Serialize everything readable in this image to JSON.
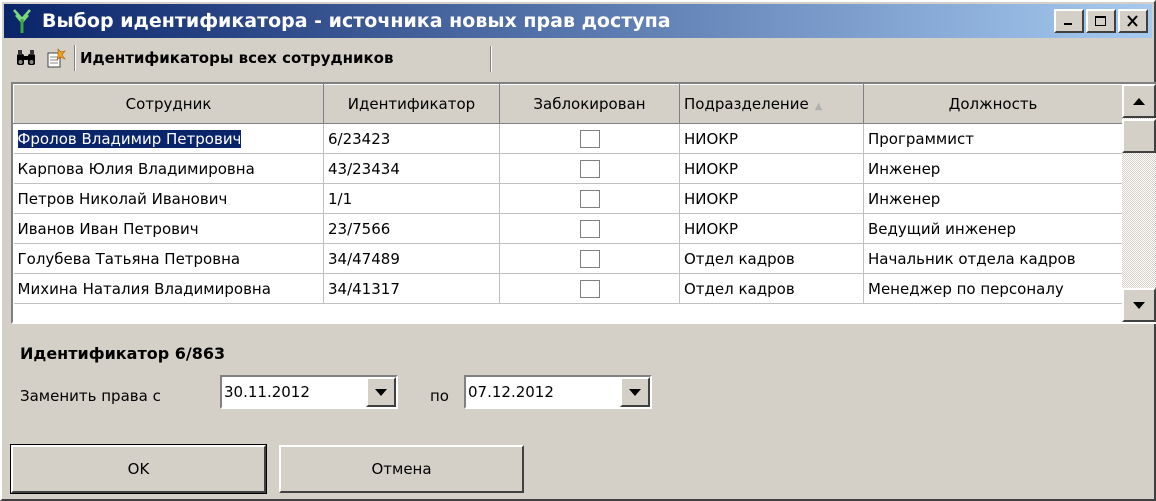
{
  "window": {
    "title": "Выбор идентификатора - источника новых прав доступа",
    "controls": {
      "minimize": "_",
      "maximize": "□",
      "close": "×"
    }
  },
  "toolbar": {
    "icons": [
      "binoculars-icon",
      "filter-wizard-icon"
    ],
    "filter_label": "Идентификаторы всех сотрудников"
  },
  "grid": {
    "columns": [
      "Сотрудник",
      "Идентификатор",
      "Заблокирован",
      "Подразделение",
      "Должность"
    ],
    "sorted_column": "Подразделение",
    "selected_row": 0,
    "rows": [
      {
        "employee": "Фролов Владимир Петрович",
        "identifier": "6/23423",
        "blocked": false,
        "department": "НИОКР",
        "position": "Программист"
      },
      {
        "employee": "Карпова Юлия Владимировна",
        "identifier": "43/23434",
        "blocked": false,
        "department": "НИОКР",
        "position": "Инженер"
      },
      {
        "employee": "Петров Николай Иванович",
        "identifier": "1/1",
        "blocked": false,
        "department": "НИОКР",
        "position": "Инженер"
      },
      {
        "employee": "Иванов Иван Петрович",
        "identifier": "23/7566",
        "blocked": false,
        "department": "НИОКР",
        "position": "Ведущий инженер"
      },
      {
        "employee": "Голубева Татьяна Петровна",
        "identifier": "34/47489",
        "blocked": false,
        "department": "Отдел кадров",
        "position": "Начальник отдела кадров"
      },
      {
        "employee": "Михина Наталия Владимировна",
        "identifier": "34/41317",
        "blocked": false,
        "department": "Отдел кадров",
        "position": "Менеджер по персоналу"
      }
    ]
  },
  "form": {
    "identifier_label": "Идентификатор 6/863",
    "replace_label": "Заменить права с",
    "date_from": "30.11.2012",
    "to_label": "по",
    "date_to": "07.12.2012"
  },
  "buttons": {
    "ok": "OK",
    "cancel": "Отмена"
  }
}
